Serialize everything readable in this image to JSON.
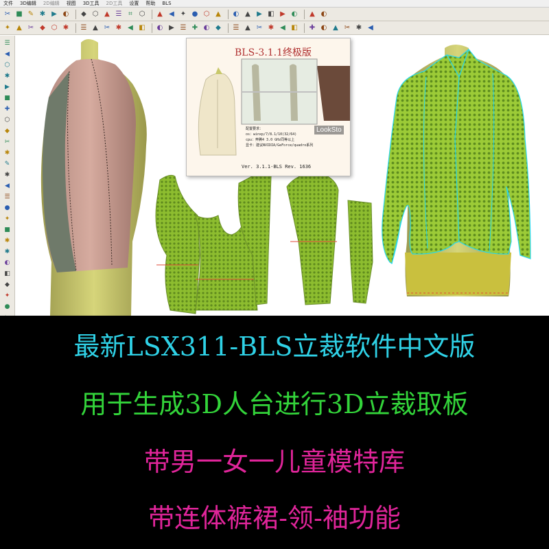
{
  "menu": [
    "文件",
    "3D编辑",
    "2D编辑",
    "视图",
    "3D工具",
    "2D工具",
    "设置",
    "帮助",
    "BLS"
  ],
  "toolbar_row1": [
    "new-icon",
    "open-icon",
    "save-icon",
    "print-icon",
    "undo-icon",
    "redo-icon",
    "hand-icon",
    "pan-icon",
    "move-icon",
    "rotate-icon",
    "fit-icon",
    "zoom-in-icon",
    "zoom-out-icon",
    "window-icon",
    "cube-icon",
    "grid-icon",
    "view-icon",
    "light-icon",
    "crosshair-icon",
    "measure-icon",
    "copy-icon",
    "paste-icon",
    "export-icon",
    "import-icon",
    "link-icon",
    "settings-icon"
  ],
  "toolbar_row2": [
    "select-icon",
    "lasso-icon",
    "layer-icon",
    "grid-view-icon",
    "triangle-icon",
    "palette-icon",
    "mannequin-1-icon",
    "mannequin-2-icon",
    "mannequin-3-icon",
    "mannequin-4-icon",
    "mannequin-5-icon",
    "mannequin-6-icon",
    "pin-icon",
    "dress-icon",
    "pen-icon",
    "needle-icon",
    "curve-1-icon",
    "curve-2-icon",
    "curve-3-icon",
    "curve-4-icon",
    "curve-5-icon",
    "curve-6-icon",
    "curve-7-icon",
    "curve-8-icon",
    "curve-9-icon",
    "curve-10-icon",
    "eraser-icon",
    "line-1-icon",
    "line-2-icon",
    "line-3-icon"
  ],
  "left_tools": [
    "arrow-icon",
    "select-box-icon",
    "pencil-icon",
    "brush-icon",
    "line-icon",
    "polyline-icon",
    "curve-icon",
    "arc-icon",
    "circle-icon",
    "rect-icon",
    "dart-icon",
    "notch-icon",
    "button-icon",
    "mirror-icon",
    "cut-icon",
    "join-icon",
    "number-icon",
    "text-icon",
    "measure-tool-icon",
    "ruler-icon",
    "rotate-tool-icon",
    "scale-icon",
    "flip-icon",
    "align-icon",
    "grade-icon",
    "seam-icon",
    "fill-icon",
    "delete-icon",
    "trash-icon",
    "copy-tool-icon"
  ],
  "splash": {
    "title": "BLS-3.1.1终极版",
    "brand": "LookSto",
    "specs": [
      "配置要求：",
      "os：winxp/7/8.1/10(32/64)",
      "cpu：奔腾4 3.0 GHz同等以上",
      "显卡：建议NVIDIA/GeForce/quadro系列"
    ],
    "version": "Ver. 3.1.1-BLS   Rev. 1636"
  },
  "banner": {
    "line1": "最新LSX311-BLS立裁软件中文版",
    "line2": "用于生成3D人台进行3D立裁取板",
    "line3": "带男一女一儿童模特库",
    "line4": "带连体裤裙-领-袖功能"
  },
  "colors": {
    "line1": "#2fd1e6",
    "line2": "#33d43a",
    "line3": "#e0259a",
    "line4": "#e0259a",
    "mannequin": "#c9c86a",
    "fabric_green": "#8dbd2f",
    "fabric_pink": "#c99a8f",
    "seam_cyan": "#27d8ee",
    "grain_red": "#e24a3a"
  }
}
